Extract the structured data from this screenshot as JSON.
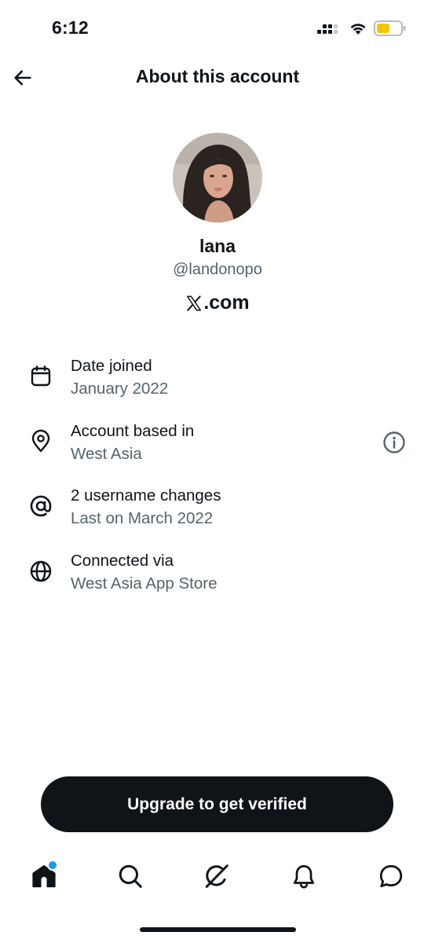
{
  "status_bar": {
    "time": "6:12",
    "battery_color": "#f5c400"
  },
  "header": {
    "title": "About this account",
    "back_icon": "arrow-left-icon"
  },
  "profile": {
    "display_name": "lana",
    "handle": "@landonopo",
    "platform_text": ".com",
    "platform_logo": "x-logo"
  },
  "info_rows": [
    {
      "icon": "calendar-icon",
      "label": "Date joined",
      "value": "January 2022"
    },
    {
      "icon": "location-pin-icon",
      "label": "Account based in",
      "value": "West Asia"
    },
    {
      "icon": "at-sign-icon",
      "label": "2 username changes",
      "value": "Last on March 2022"
    },
    {
      "icon": "globe-icon",
      "label": "Connected via",
      "value": "West Asia App Store"
    }
  ],
  "cta": {
    "label": "Upgrade to get verified"
  },
  "bottom_nav": {
    "items": [
      "home-icon",
      "search-icon",
      "grok-icon",
      "notifications-bell-icon",
      "messages-icon"
    ],
    "notification_dot_color": "#1d9bf0"
  },
  "colors": {
    "text_primary": "#0f1419",
    "text_secondary": "#536471",
    "button_bg": "#0f1419",
    "button_text": "#ffffff"
  }
}
